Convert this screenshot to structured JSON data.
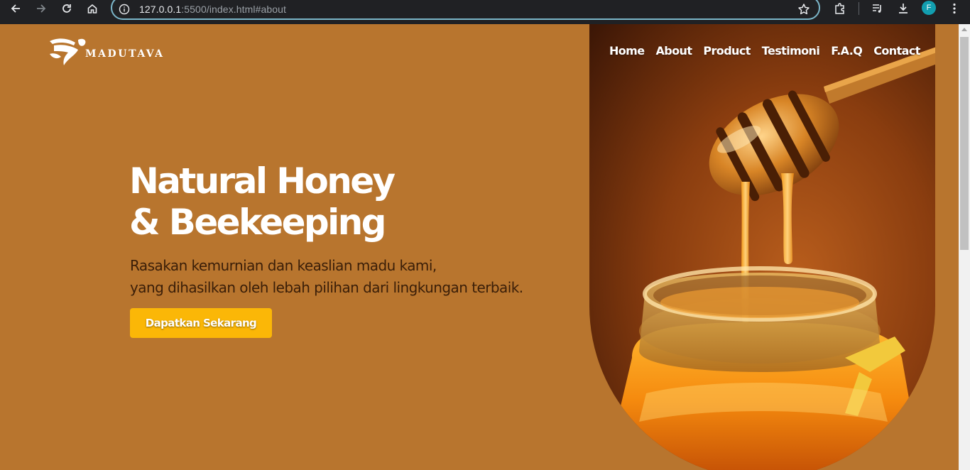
{
  "browser": {
    "url_host": "127.0.0.1",
    "url_rest": ":5500/index.html#about",
    "profile_initial": "F",
    "icons": [
      "back-arrow-icon",
      "forward-arrow-icon",
      "reload-icon",
      "home-icon",
      "site-info-icon",
      "bookmark-star-icon",
      "extensions-icon",
      "media-queue-icon",
      "download-icon",
      "kebab-menu-icon"
    ]
  },
  "brand": {
    "name": "MADUTAVA",
    "logo_icon": "bee-logo-icon"
  },
  "nav": {
    "items": [
      {
        "label": "Home"
      },
      {
        "label": "About"
      },
      {
        "label": "Product"
      },
      {
        "label": "Testimoni"
      },
      {
        "label": "F.A.Q"
      },
      {
        "label": "Contact"
      }
    ]
  },
  "hero": {
    "title_line1": "Natural Honey",
    "title_line2": "& Beekeeping",
    "subtitle_line1": "Rasakan kemurnian dan keaslian madu kami,",
    "subtitle_line2": "yang dihasilkan oleh lebah pilihan dari lingkungan terbaik.",
    "cta_label": "Dapatkan Sekarang",
    "image_subject": "honey-dipper-jar-image"
  },
  "colors": {
    "page_background": "#b8752e",
    "cta_background": "#fbb707",
    "subtitle_text": "#3a1e08",
    "chrome_background": "#202124",
    "omnibox_focus": "#7bb6c9",
    "avatar": "#129eaf"
  }
}
